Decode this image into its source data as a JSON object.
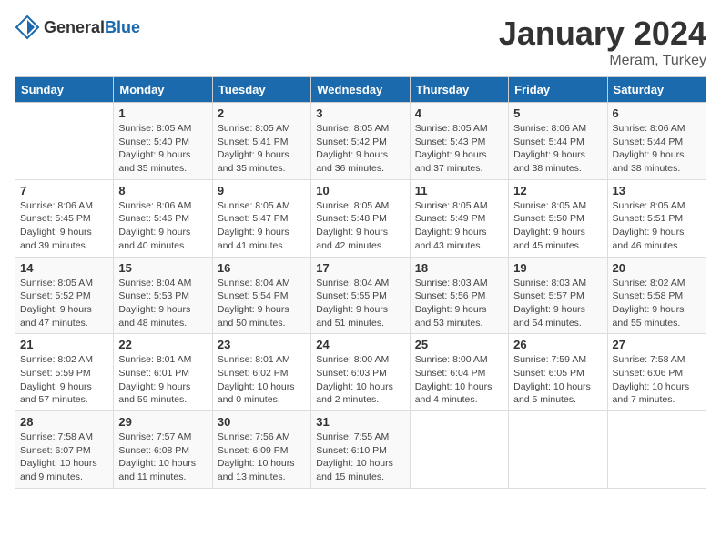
{
  "logo": {
    "general": "General",
    "blue": "Blue"
  },
  "title": "January 2024",
  "location": "Meram, Turkey",
  "days_of_week": [
    "Sunday",
    "Monday",
    "Tuesday",
    "Wednesday",
    "Thursday",
    "Friday",
    "Saturday"
  ],
  "weeks": [
    [
      {
        "day": "",
        "sunrise": "",
        "sunset": "",
        "daylight": ""
      },
      {
        "day": "1",
        "sunrise": "Sunrise: 8:05 AM",
        "sunset": "Sunset: 5:40 PM",
        "daylight": "Daylight: 9 hours and 35 minutes."
      },
      {
        "day": "2",
        "sunrise": "Sunrise: 8:05 AM",
        "sunset": "Sunset: 5:41 PM",
        "daylight": "Daylight: 9 hours and 35 minutes."
      },
      {
        "day": "3",
        "sunrise": "Sunrise: 8:05 AM",
        "sunset": "Sunset: 5:42 PM",
        "daylight": "Daylight: 9 hours and 36 minutes."
      },
      {
        "day": "4",
        "sunrise": "Sunrise: 8:05 AM",
        "sunset": "Sunset: 5:43 PM",
        "daylight": "Daylight: 9 hours and 37 minutes."
      },
      {
        "day": "5",
        "sunrise": "Sunrise: 8:06 AM",
        "sunset": "Sunset: 5:44 PM",
        "daylight": "Daylight: 9 hours and 38 minutes."
      },
      {
        "day": "6",
        "sunrise": "Sunrise: 8:06 AM",
        "sunset": "Sunset: 5:44 PM",
        "daylight": "Daylight: 9 hours and 38 minutes."
      }
    ],
    [
      {
        "day": "7",
        "sunrise": "Sunrise: 8:06 AM",
        "sunset": "Sunset: 5:45 PM",
        "daylight": "Daylight: 9 hours and 39 minutes."
      },
      {
        "day": "8",
        "sunrise": "Sunrise: 8:06 AM",
        "sunset": "Sunset: 5:46 PM",
        "daylight": "Daylight: 9 hours and 40 minutes."
      },
      {
        "day": "9",
        "sunrise": "Sunrise: 8:05 AM",
        "sunset": "Sunset: 5:47 PM",
        "daylight": "Daylight: 9 hours and 41 minutes."
      },
      {
        "day": "10",
        "sunrise": "Sunrise: 8:05 AM",
        "sunset": "Sunset: 5:48 PM",
        "daylight": "Daylight: 9 hours and 42 minutes."
      },
      {
        "day": "11",
        "sunrise": "Sunrise: 8:05 AM",
        "sunset": "Sunset: 5:49 PM",
        "daylight": "Daylight: 9 hours and 43 minutes."
      },
      {
        "day": "12",
        "sunrise": "Sunrise: 8:05 AM",
        "sunset": "Sunset: 5:50 PM",
        "daylight": "Daylight: 9 hours and 45 minutes."
      },
      {
        "day": "13",
        "sunrise": "Sunrise: 8:05 AM",
        "sunset": "Sunset: 5:51 PM",
        "daylight": "Daylight: 9 hours and 46 minutes."
      }
    ],
    [
      {
        "day": "14",
        "sunrise": "Sunrise: 8:05 AM",
        "sunset": "Sunset: 5:52 PM",
        "daylight": "Daylight: 9 hours and 47 minutes."
      },
      {
        "day": "15",
        "sunrise": "Sunrise: 8:04 AM",
        "sunset": "Sunset: 5:53 PM",
        "daylight": "Daylight: 9 hours and 48 minutes."
      },
      {
        "day": "16",
        "sunrise": "Sunrise: 8:04 AM",
        "sunset": "Sunset: 5:54 PM",
        "daylight": "Daylight: 9 hours and 50 minutes."
      },
      {
        "day": "17",
        "sunrise": "Sunrise: 8:04 AM",
        "sunset": "Sunset: 5:55 PM",
        "daylight": "Daylight: 9 hours and 51 minutes."
      },
      {
        "day": "18",
        "sunrise": "Sunrise: 8:03 AM",
        "sunset": "Sunset: 5:56 PM",
        "daylight": "Daylight: 9 hours and 53 minutes."
      },
      {
        "day": "19",
        "sunrise": "Sunrise: 8:03 AM",
        "sunset": "Sunset: 5:57 PM",
        "daylight": "Daylight: 9 hours and 54 minutes."
      },
      {
        "day": "20",
        "sunrise": "Sunrise: 8:02 AM",
        "sunset": "Sunset: 5:58 PM",
        "daylight": "Daylight: 9 hours and 55 minutes."
      }
    ],
    [
      {
        "day": "21",
        "sunrise": "Sunrise: 8:02 AM",
        "sunset": "Sunset: 5:59 PM",
        "daylight": "Daylight: 9 hours and 57 minutes."
      },
      {
        "day": "22",
        "sunrise": "Sunrise: 8:01 AM",
        "sunset": "Sunset: 6:01 PM",
        "daylight": "Daylight: 9 hours and 59 minutes."
      },
      {
        "day": "23",
        "sunrise": "Sunrise: 8:01 AM",
        "sunset": "Sunset: 6:02 PM",
        "daylight": "Daylight: 10 hours and 0 minutes."
      },
      {
        "day": "24",
        "sunrise": "Sunrise: 8:00 AM",
        "sunset": "Sunset: 6:03 PM",
        "daylight": "Daylight: 10 hours and 2 minutes."
      },
      {
        "day": "25",
        "sunrise": "Sunrise: 8:00 AM",
        "sunset": "Sunset: 6:04 PM",
        "daylight": "Daylight: 10 hours and 4 minutes."
      },
      {
        "day": "26",
        "sunrise": "Sunrise: 7:59 AM",
        "sunset": "Sunset: 6:05 PM",
        "daylight": "Daylight: 10 hours and 5 minutes."
      },
      {
        "day": "27",
        "sunrise": "Sunrise: 7:58 AM",
        "sunset": "Sunset: 6:06 PM",
        "daylight": "Daylight: 10 hours and 7 minutes."
      }
    ],
    [
      {
        "day": "28",
        "sunrise": "Sunrise: 7:58 AM",
        "sunset": "Sunset: 6:07 PM",
        "daylight": "Daylight: 10 hours and 9 minutes."
      },
      {
        "day": "29",
        "sunrise": "Sunrise: 7:57 AM",
        "sunset": "Sunset: 6:08 PM",
        "daylight": "Daylight: 10 hours and 11 minutes."
      },
      {
        "day": "30",
        "sunrise": "Sunrise: 7:56 AM",
        "sunset": "Sunset: 6:09 PM",
        "daylight": "Daylight: 10 hours and 13 minutes."
      },
      {
        "day": "31",
        "sunrise": "Sunrise: 7:55 AM",
        "sunset": "Sunset: 6:10 PM",
        "daylight": "Daylight: 10 hours and 15 minutes."
      },
      {
        "day": "",
        "sunrise": "",
        "sunset": "",
        "daylight": ""
      },
      {
        "day": "",
        "sunrise": "",
        "sunset": "",
        "daylight": ""
      },
      {
        "day": "",
        "sunrise": "",
        "sunset": "",
        "daylight": ""
      }
    ]
  ]
}
